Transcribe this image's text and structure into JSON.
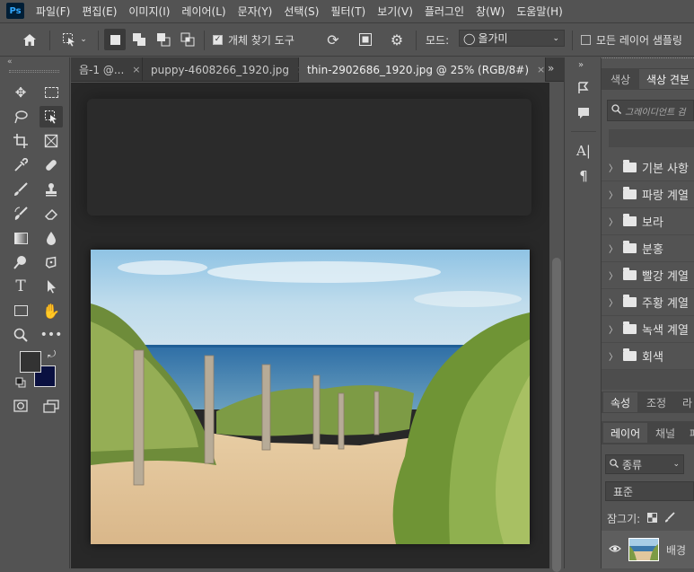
{
  "app": {
    "logo": "Ps"
  },
  "menu": [
    "파일(F)",
    "편집(E)",
    "이미지(I)",
    "레이어(L)",
    "문자(Y)",
    "선택(S)",
    "필터(T)",
    "보기(V)",
    "플러그인",
    "창(W)",
    "도움말(H)"
  ],
  "options_bar": {
    "auto_select_label": "개체 찾기 도구",
    "mode_label": "모드:",
    "mode_value": "올가미",
    "sample_all_label": "모든 레이어 샘플링"
  },
  "tabs": [
    {
      "label": "음-1 @...",
      "close": "×"
    },
    {
      "label": "puppy-4608266_1920.jpg",
      "close": "×"
    },
    {
      "label": "thin-2902686_1920.jpg @ 25% (RGB/8#)",
      "close": "×"
    }
  ],
  "right_panel": {
    "top_tabs": [
      "색상",
      "색상 견본"
    ],
    "gradient_search_placeholder": "그레이디언트 검",
    "gradient_groups": [
      "기본 사항",
      "파랑 계열",
      "보라",
      "분홍",
      "빨강 계열",
      "주황 계열",
      "녹색 계열",
      "회색"
    ],
    "prop_tabs": [
      "속성",
      "조정",
      "라"
    ],
    "layer_tabs": [
      "레이어",
      "채널",
      "패"
    ],
    "layer_filter": "종류",
    "blend_mode": "표준",
    "lock_label": "잠그기:",
    "layers": [
      {
        "name": "배경"
      }
    ]
  },
  "colors": {
    "foreground": "#333333",
    "background": "#0a1040",
    "accent": "#31a8ff"
  }
}
